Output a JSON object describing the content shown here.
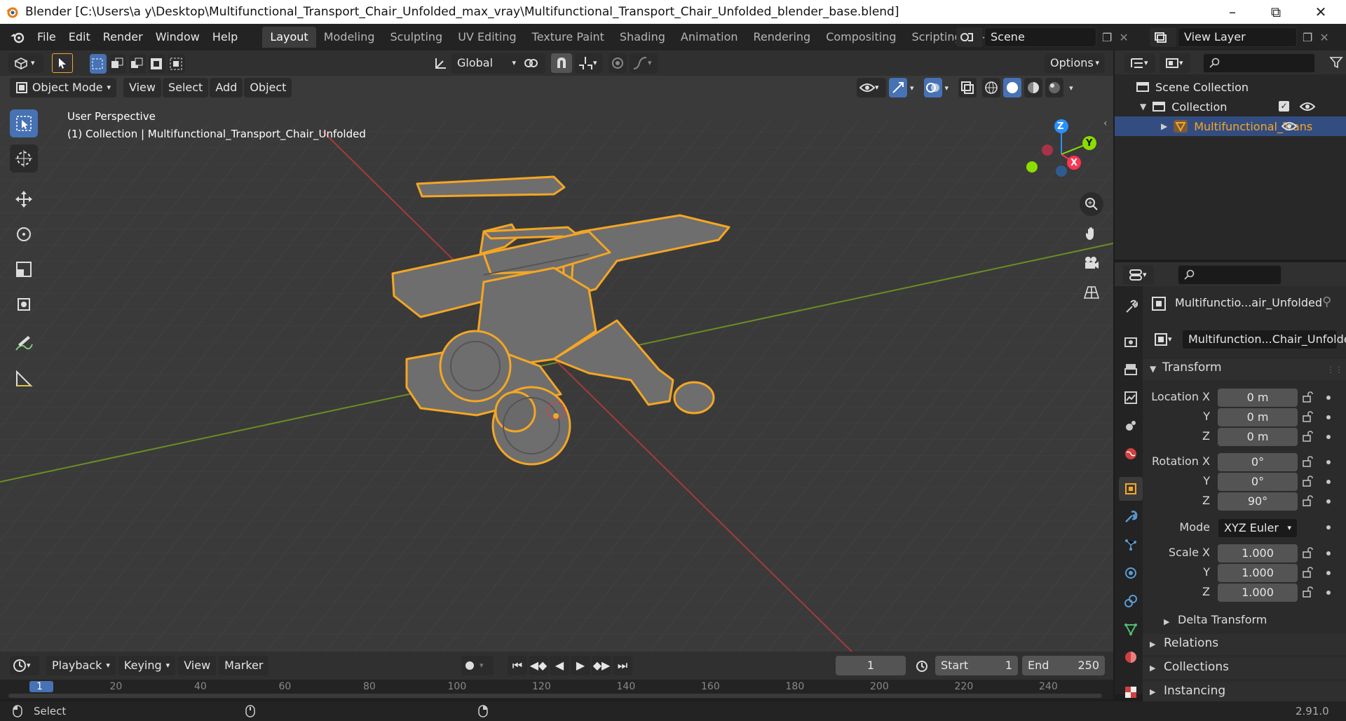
{
  "window": {
    "title": "Blender [C:\\Users\\a y\\Desktop\\Multifunctional_Transport_Chair_Unfolded_max_vray\\Multifunctional_Transport_Chair_Unfolded_blender_base.blend]"
  },
  "menu": [
    "File",
    "Edit",
    "Render",
    "Window",
    "Help"
  ],
  "workspaces": [
    "Layout",
    "Modeling",
    "Sculpting",
    "UV Editing",
    "Texture Paint",
    "Shading",
    "Animation",
    "Rendering",
    "Compositing",
    "Scripting"
  ],
  "scene": {
    "name": "Scene",
    "view_layer": "View Layer"
  },
  "toolbar": {
    "transform_orientation": "Global",
    "options": "Options"
  },
  "viewport_header": {
    "mode": "Object Mode",
    "menus": [
      "View",
      "Select",
      "Add",
      "Object"
    ]
  },
  "viewport": {
    "perspective": "User Perspective",
    "collection_info": "(1) Collection | Multifunctional_Transport_Chair_Unfolded"
  },
  "gizmo": {
    "z": "Z",
    "y": "Y",
    "x": "X"
  },
  "outliner": {
    "scene_collection": "Scene Collection",
    "collection": "Collection",
    "object": "Multifunctional_Trans"
  },
  "properties": {
    "object_name": "Multifunctio...air_Unfolded",
    "data_name": "Multifunction...Chair_Unfolded",
    "transform_label": "Transform",
    "location": {
      "label": "Location X",
      "x": "0 m",
      "y": "0 m",
      "z": "0 m"
    },
    "rotation": {
      "label": "Rotation X",
      "x": "0°",
      "y": "0°",
      "z": "90°"
    },
    "mode_label": "Mode",
    "mode_value": "XYZ Euler",
    "scale": {
      "label": "Scale X",
      "x": "1.000",
      "y": "1.000",
      "z": "1.000"
    },
    "axis_y": "Y",
    "axis_z": "Z",
    "sections": [
      "Delta Transform",
      "Relations",
      "Collections",
      "Instancing"
    ]
  },
  "timeline": {
    "menus": [
      "Playback",
      "Keying",
      "View",
      "Marker"
    ],
    "current_frame": "1",
    "start_label": "Start",
    "start": "1",
    "end_label": "End",
    "end": "250",
    "ruler": [
      "1",
      "20",
      "40",
      "60",
      "80",
      "100",
      "120",
      "140",
      "160",
      "180",
      "200",
      "220",
      "240"
    ]
  },
  "status": {
    "left": "Select",
    "version": "2.91.0"
  },
  "colors": {
    "accent": "#4772b3",
    "selection": "#f5a623",
    "x_axis": "#ff3352",
    "y_axis": "#8bdc00",
    "z_axis": "#2890ff"
  }
}
